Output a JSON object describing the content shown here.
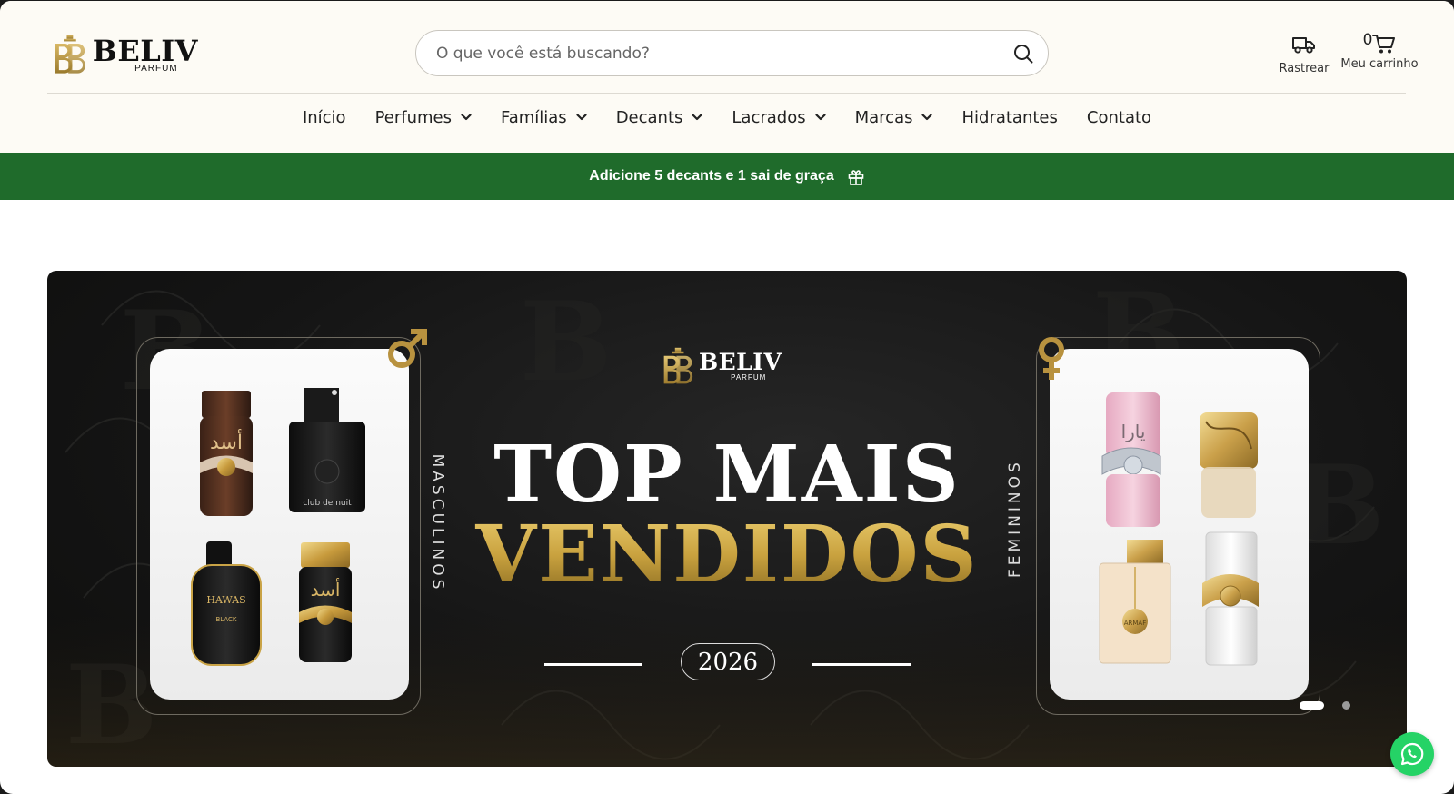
{
  "brand": {
    "name": "BELIV",
    "sub": "PARFUM",
    "gold": "#b8923f"
  },
  "search": {
    "placeholder": "O que você está buscando?"
  },
  "header_actions": {
    "track_label": "Rastrear",
    "cart_label": "Meu carrinho",
    "cart_count": "0"
  },
  "nav": {
    "items": [
      {
        "label": "Início",
        "dropdown": false
      },
      {
        "label": "Perfumes",
        "dropdown": true
      },
      {
        "label": "Famílias",
        "dropdown": true
      },
      {
        "label": "Decants",
        "dropdown": true
      },
      {
        "label": "Lacrados",
        "dropdown": true
      },
      {
        "label": "Marcas",
        "dropdown": true
      },
      {
        "label": "Hidratantes",
        "dropdown": false
      },
      {
        "label": "Contato",
        "dropdown": false
      }
    ]
  },
  "promo": {
    "text": "Adicione 5 decants e 1 sai de graça",
    "icon": "gift-icon",
    "color": "#1f6b2b"
  },
  "banner": {
    "logo_word": "BELIV",
    "logo_sub": "PARFUM",
    "title_line1": "TOP MAIS",
    "title_line2": "VENDIDOS",
    "year": "2026",
    "left_label": "MASCULINOS",
    "right_label": "FEMININOS",
    "left_products": [
      {
        "name": "Asad Bourbon",
        "label": "أسد"
      },
      {
        "name": "Club de Nuit Intense Man",
        "label": "club de nuit"
      },
      {
        "name": "Hawas Black",
        "label": "HAWAS"
      },
      {
        "name": "Asad",
        "label": "أسد"
      }
    ],
    "right_products": [
      {
        "name": "Yara",
        "label": "يارا"
      },
      {
        "name": "Khamrah Qahwa",
        "label": ""
      },
      {
        "name": "Club de Nuit Women",
        "label": "ARMAF"
      },
      {
        "name": "Yara Moi",
        "label": ""
      }
    ],
    "slides": {
      "active": 1,
      "count": 2
    }
  },
  "whatsapp": {
    "icon": "whatsapp-icon",
    "color": "#25d366"
  }
}
